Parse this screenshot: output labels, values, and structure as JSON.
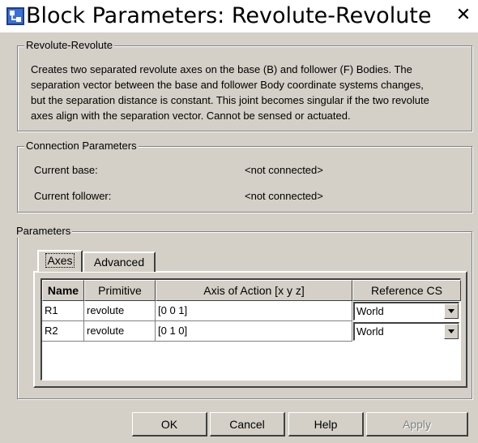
{
  "window": {
    "title": "Block Parameters: Revolute-Revolute",
    "close_label": "✕"
  },
  "description_group": {
    "legend": "Revolute-Revolute",
    "lines": [
      "Creates two separated revolute axes on the base (B) and follower (F) Bodies. The",
      "separation vector between the base and follower Body coordinate systems changes,",
      "but the separation distance is constant. This joint becomes singular if the two revolute",
      "axes align with the separation vector. Cannot be sensed or actuated."
    ]
  },
  "connection": {
    "legend": "Connection Parameters",
    "base_label": "Current base:",
    "base_value": "<not connected>",
    "follower_label": "Current follower:",
    "follower_value": "<not connected>"
  },
  "parameters": {
    "legend": "Parameters",
    "tabs": [
      "Axes",
      "Advanced"
    ],
    "active_tab": "Axes",
    "columns": [
      "Name",
      "Primitive",
      "Axis of Action [x y z]",
      "Reference CS"
    ],
    "rows": [
      {
        "name": "R1",
        "primitive": "revolute",
        "axis": "[0 0 1]",
        "reference": "World"
      },
      {
        "name": "R2",
        "primitive": "revolute",
        "axis": "[0 1 0]",
        "reference": "World"
      }
    ]
  },
  "buttons": {
    "ok": "OK",
    "cancel": "Cancel",
    "help": "Help",
    "apply": "Apply",
    "apply_enabled": false
  },
  "colors": {
    "dialog_bg": "#d4d0c8",
    "title_bg": "#ffffff",
    "table_bg": "#ffffff"
  },
  "icons": {
    "title": "simulink-block-icon",
    "close": "close-icon",
    "dropdown": "chevron-down-icon"
  }
}
